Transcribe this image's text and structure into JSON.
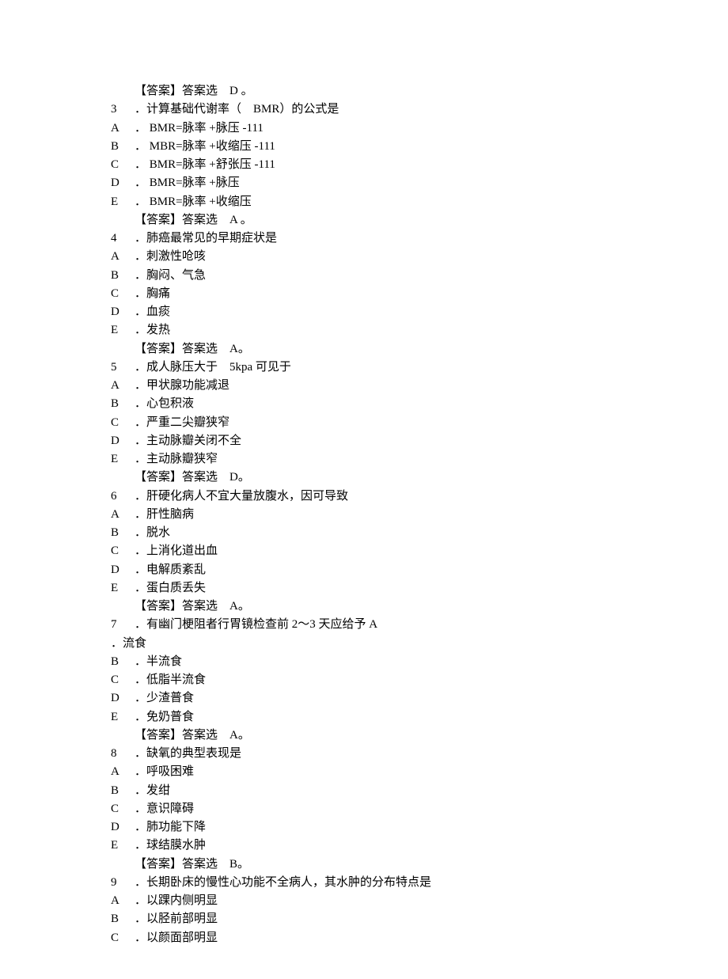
{
  "q2": {
    "answer": "【答案】答案选　D 。"
  },
  "q3": {
    "stem": "．计算基础代谢率（　BMR）的公式是",
    "opts": {
      "A": "． BMR=脉率 +脉压 -111",
      "B": "． MBR=脉率 +收缩压 -111",
      "C": "． BMR=脉率 +舒张压 -111",
      "D": "． BMR=脉率 +脉压",
      "E": "． BMR=脉率 +收缩压"
    },
    "answer": "【答案】答案选　A 。"
  },
  "q4": {
    "stem": "．肺癌最常见的早期症状是",
    "opts": {
      "A": "．刺激性呛咳",
      "B": "．胸闷、气急",
      "C": "．胸痛",
      "D": "．血痰",
      "E": "．发热"
    },
    "answer": "【答案】答案选　A。"
  },
  "q5": {
    "stem": "．成人脉压大于　5kpa 可见于",
    "opts": {
      "A": "．甲状腺功能减退",
      "B": "．心包积液",
      "C": "．严重二尖瓣狭窄",
      "D": "．主动脉瓣关闭不全",
      "E": "．主动脉瓣狭窄"
    },
    "answer": "【答案】答案选　D。"
  },
  "q6": {
    "stem": "．肝硬化病人不宜大量放腹水，因可导致",
    "opts": {
      "A": "．肝性脑病",
      "B": "．脱水",
      "C": "．上消化道出血",
      "D": "．电解质紊乱",
      "E": "．蛋白质丢失"
    },
    "answer": "【答案】答案选　A。"
  },
  "q7": {
    "stem": "．有幽门梗阻者行胃镜检查前 2～3 天应给予 A",
    "optA": "．流食",
    "opts": {
      "B": "．半流食",
      "C": "．低脂半流食",
      "D": "．少渣普食",
      "E": "．免奶普食"
    },
    "answer": "【答案】答案选　A。"
  },
  "q8": {
    "stem": "．缺氧的典型表现是",
    "opts": {
      "A": "．呼吸困难",
      "B": "．发绀",
      "C": "．意识障碍",
      "D": "．肺功能下降",
      "E": "．球结膜水肿"
    },
    "answer": "【答案】答案选　B。"
  },
  "q9": {
    "stem": "．长期卧床的慢性心功能不全病人，其水肿的分布特点是",
    "opts": {
      "A": "．以踝内侧明显",
      "B": "．以胫前部明显",
      "C": "．以颜面部明显"
    }
  }
}
